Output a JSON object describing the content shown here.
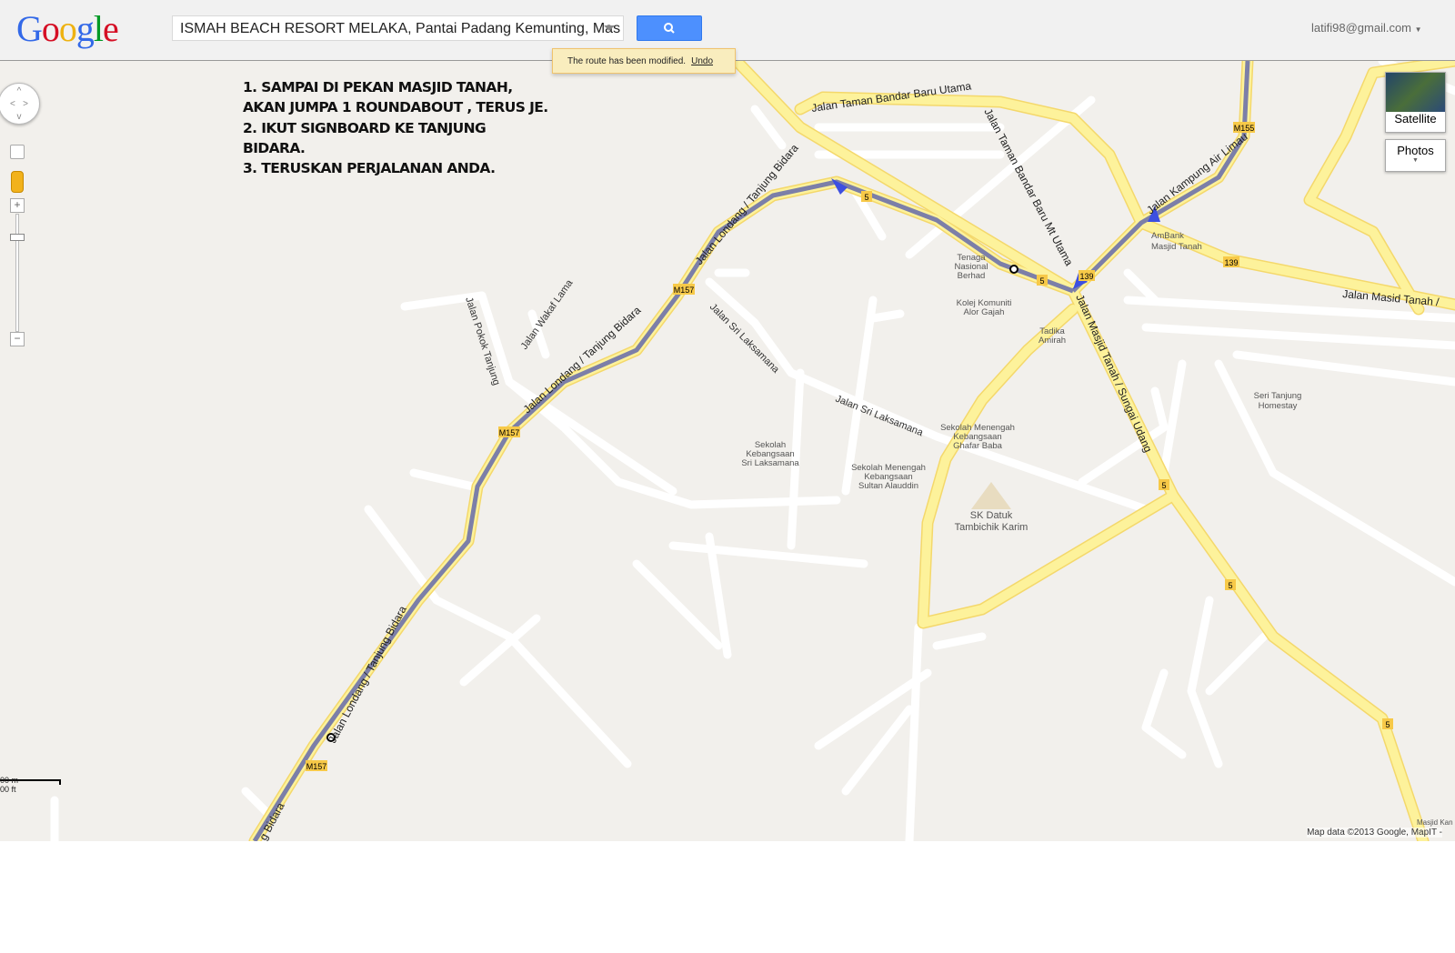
{
  "header": {
    "logo": "Google",
    "search_value": "ISMAH BEACH RESORT MELAKA, Pantai Padang Kemunting, Mas",
    "search_icon": "magnifier-icon",
    "account": "latifi98@gmail.com"
  },
  "toast": {
    "message": "The route has been modified.",
    "undo": "Undo"
  },
  "notes": [
    "1. SAMPAI DI PEKAN MASJID TANAH,",
    "AKAN JUMPA 1 ROUNDABOUT , TERUS JE.",
    "2. IKUT SIGNBOARD KE TANJUNG",
    "BIDARA.",
    "3. TERUSKAN PERJALANAN ANDA."
  ],
  "controls": {
    "satellite": "Satellite",
    "photos": "Photos"
  },
  "scale": {
    "metric": "00 m",
    "imperial": "00 ft"
  },
  "attribution": "Map data ©2013 Google, MapIT -",
  "colors": {
    "road": "#fdf29b",
    "road_edge": "#f4d86b",
    "route": "#7c7fa8",
    "arrow": "#3d4fe0",
    "land": "#f2f0ec"
  },
  "roads": {
    "r1": "Jalan Taman Bandar Baru Utama",
    "r2": "Jalan Taman Bandar Baru Mt Utama",
    "r3": "Jalan Kampung Air Limau",
    "r4": "Jalan Londang / Tanjung Bidara",
    "r5": "Jalan Londang / Tanjung Bidara",
    "r6": "Jalan Londang / Tanjung Bidara",
    "r7": "Jalan Masjid Tanah / Sungai Udang",
    "r8": "Jalan Masid Tanah /",
    "r9": "Jalan Sri Laksamana",
    "r10": "Jalan Sri Laksamana",
    "r11": "Jalan Pokok Tanjung",
    "r12": "Jalan Wakaf Lama",
    "r13": "g Bidara"
  },
  "shields": {
    "m157": "M157",
    "m155": "M155",
    "r5": "5",
    "r139": "139"
  },
  "pois": {
    "p1": [
      "AmBank",
      "Masjid Tanah"
    ],
    "p2": [
      "Tenaga",
      "Nasional",
      "Berhad"
    ],
    "p3": [
      "Kolej Komuniti",
      "Alor Gajah"
    ],
    "p4": [
      "Tadika",
      "Amirah"
    ],
    "p5": [
      "Seri Tanjung",
      "Homestay"
    ],
    "p6": [
      "Sekolah Menengah",
      "Kebangsaan",
      "Ghafar Baba"
    ],
    "p7": [
      "Sekolah",
      "Kebangsaan",
      "Sri Laksamana"
    ],
    "p8": [
      "Sekolah Menengah",
      "Kebangsaan",
      "Sultan Alauddin"
    ],
    "p9": [
      "SK Datuk",
      "Tambichik Karim"
    ],
    "p10": "Masjid Kan"
  }
}
